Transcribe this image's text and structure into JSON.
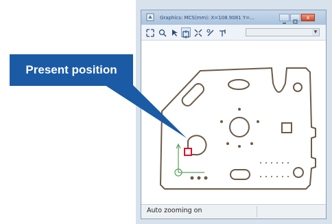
{
  "window": {
    "title": "Graphics: MCS(mm): X=108.9081 Y=...",
    "close_glyph": "x"
  },
  "toolbar": {
    "icons": [
      "fit-icon",
      "zoom-icon",
      "pointer-icon",
      "zoom-window-icon",
      "zoom-extent-icon",
      "measure-icon",
      "pan-icon"
    ],
    "selected_icon": "zoom-window-icon"
  },
  "status": {
    "text": "Auto zooming on"
  },
  "callout": {
    "text": "Present position"
  },
  "colors": {
    "callout": "#1b5ba6",
    "part_outline": "#6b5a48",
    "position_marker": "#e0102a",
    "axes": "#5aa05a"
  }
}
